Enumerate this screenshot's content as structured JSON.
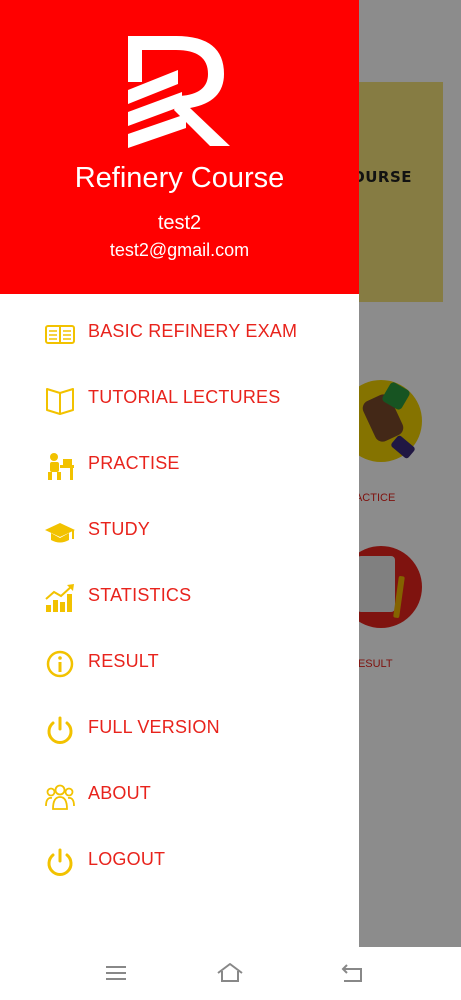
{
  "background": {
    "banner_text": "OURSE",
    "tile_labels": [
      "RACTICE",
      "RESULT"
    ]
  },
  "drawer": {
    "header": {
      "app_title": "Refinery Course",
      "user_name": "test2",
      "user_email": "test2@gmail.com",
      "logo_icon": "refinery-r-logo",
      "background_color": "#ff0000"
    },
    "accent_text_color": "#e8231c",
    "icon_color": "#f2c200",
    "items": [
      {
        "label": "BASIC REFINERY EXAM",
        "icon": "book-icon"
      },
      {
        "label": "TUTORIAL LECTURES",
        "icon": "open-book-icon"
      },
      {
        "label": "PRACTISE",
        "icon": "student-desk-icon"
      },
      {
        "label": "STUDY",
        "icon": "graduation-cap-icon"
      },
      {
        "label": "STATISTICS",
        "icon": "growth-chart-icon"
      },
      {
        "label": "RESULT",
        "icon": "info-icon"
      },
      {
        "label": "FULL VERSION",
        "icon": "power-icon"
      },
      {
        "label": "ABOUT",
        "icon": "people-icon"
      },
      {
        "label": "LOGOUT",
        "icon": "power-icon"
      }
    ]
  },
  "navbar": {
    "buttons": [
      "menu-icon",
      "home-icon",
      "back-icon"
    ]
  }
}
